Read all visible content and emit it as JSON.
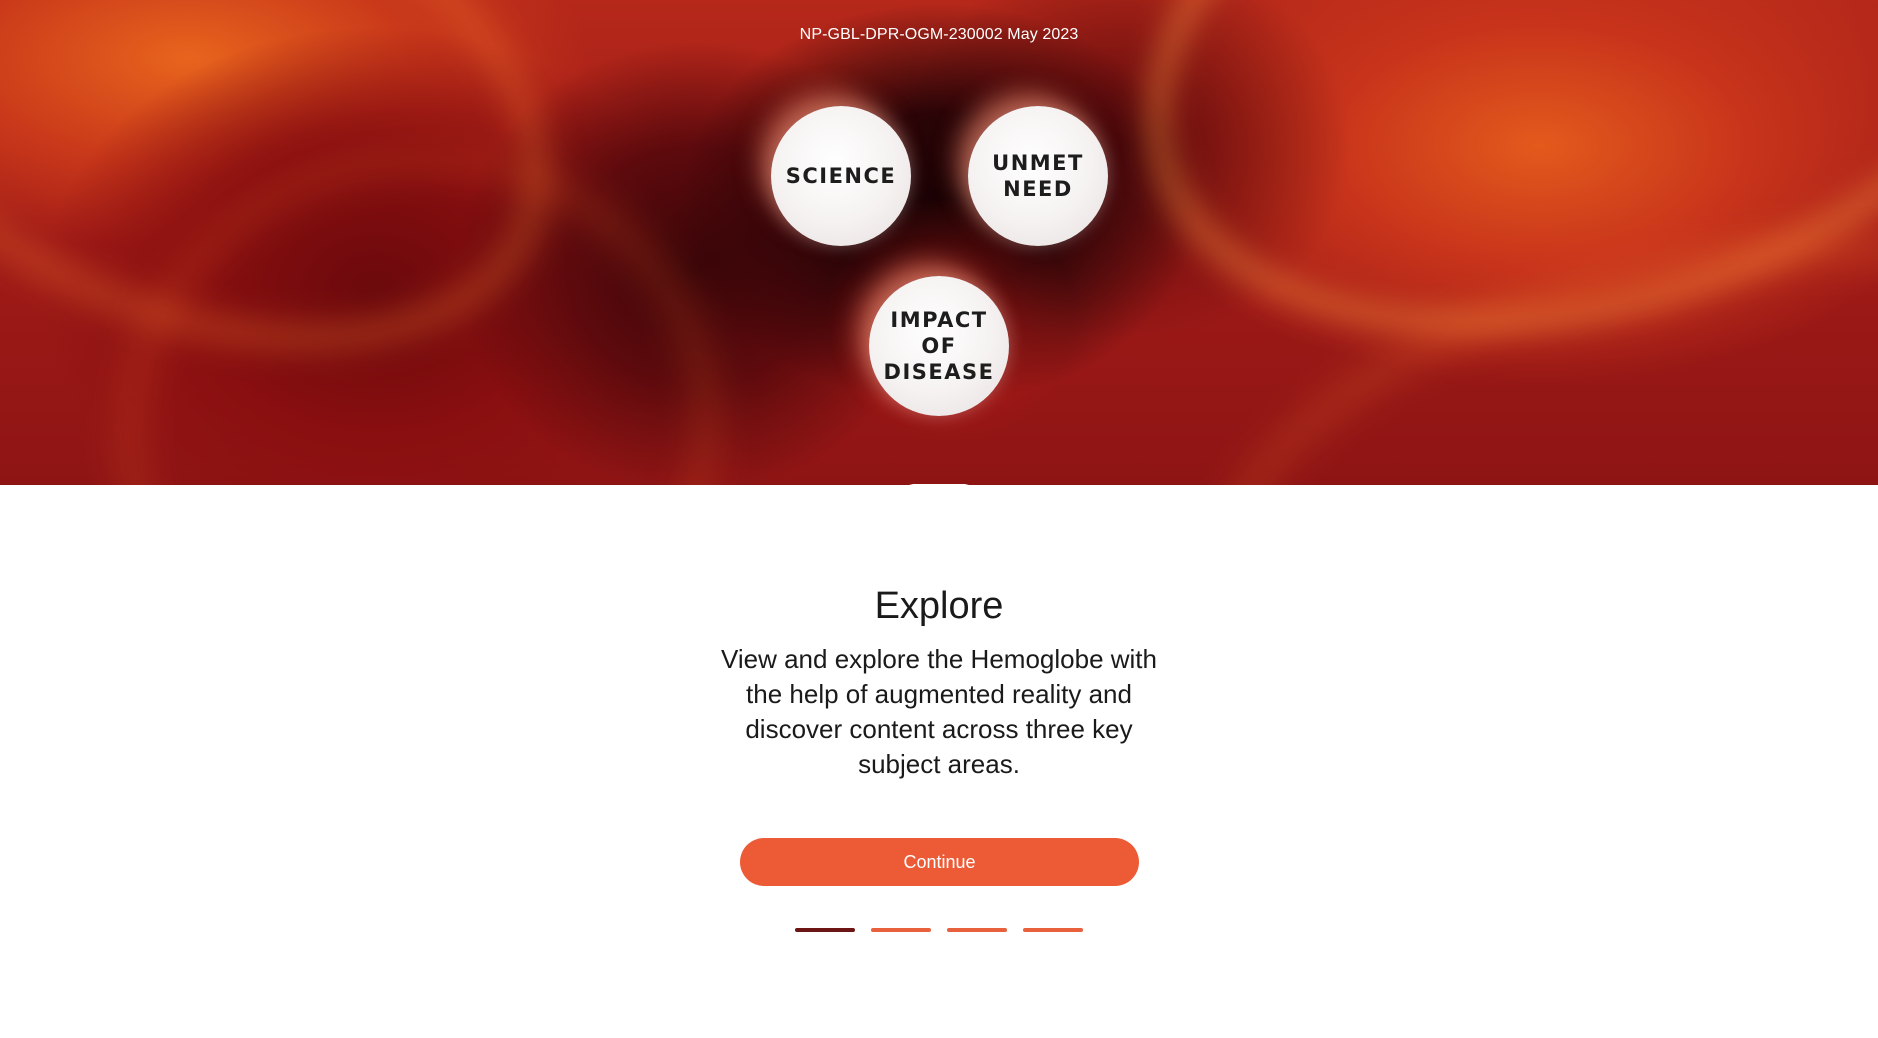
{
  "hero": {
    "reference_code": "NP-GBL-DPR-OGM-230002 May 2023",
    "topics": [
      {
        "label": "SCIENCE"
      },
      {
        "label": "UNMET\nNEED"
      },
      {
        "label": "IMPACT\nOF\nDISEASE"
      }
    ]
  },
  "content": {
    "heading": "Explore",
    "body": "View and explore the Hemoglobe with the help of augmented reality and discover content across three key subject areas.",
    "continue_label": "Continue"
  },
  "pager": {
    "total_pages": 4,
    "current_page": 1
  },
  "colors": {
    "accent": "#ec5a36",
    "pager_active": "#6d1414",
    "pager_inactive": "#e8603c",
    "hero_dark": "#2a0407",
    "hero_orange": "#e35a1c"
  }
}
